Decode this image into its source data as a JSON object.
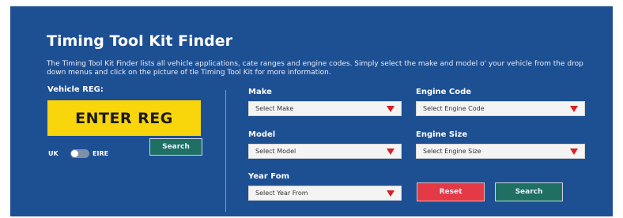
{
  "title": "Timing Tool Kit Finder",
  "description": "The Timing Tool Kit Finder lists all vehicle applications, cate ranges and engine codes. Simply select the make and model o' your vehicle from the drop down menus and click on the picture of tle Timing Tool Kit for more information.",
  "reg": {
    "label": "Vehicle REG:",
    "placeholder": "ENTER REG",
    "toggle_left": "UK",
    "toggle_right": "EIRE",
    "search_label": "Search"
  },
  "selects": {
    "make": {
      "label": "Make",
      "value": "Select Make"
    },
    "model": {
      "label": "Model",
      "value": "Select Model"
    },
    "year_from": {
      "label": "Year Fom",
      "value": "Select Year From"
    },
    "engine_code": {
      "label": "Engine Code",
      "value": "Select Engine Code"
    },
    "engine_size": {
      "label": "Engine Size",
      "value": "Select Engine Size"
    }
  },
  "buttons": {
    "reset": "Reset",
    "search": "Search"
  },
  "colors": {
    "panel": "#1d4f93",
    "reg_box": "#f9d50c",
    "search_button": "#1f7063",
    "reset_button": "#e33a46",
    "select_arrow": "#d62027"
  }
}
